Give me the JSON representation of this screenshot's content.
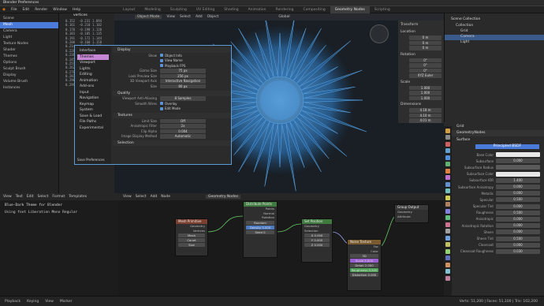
{
  "app": {
    "title": "Blender Preferences"
  },
  "topbar": {
    "items": [
      "File",
      "Edit",
      "Render",
      "Window",
      "Help",
      "Layout",
      "Modeling",
      "Sculpting",
      "UV Editing",
      "Texture Paint",
      "Shading",
      "Animation",
      "Rendering",
      "Compositing",
      "Geometry Nodes",
      "Scripting"
    ]
  },
  "tabs": [
    {
      "label": "Layout",
      "active": false
    },
    {
      "label": "Modeling",
      "active": false
    },
    {
      "label": "Sculpting",
      "active": false
    },
    {
      "label": "UV Editing",
      "active": false
    },
    {
      "label": "Shading",
      "active": false
    },
    {
      "label": "Animation",
      "active": false
    },
    {
      "label": "Rendering",
      "active": false
    },
    {
      "label": "Compositing",
      "active": false
    },
    {
      "label": "Geometry Nodes",
      "active": true
    },
    {
      "label": "Scripting",
      "active": false
    }
  ],
  "outliner": {
    "items": [
      {
        "label": "Scene",
        "sel": false
      },
      {
        "label": "Mesh",
        "sel": true
      },
      {
        "label": "Camera",
        "sel": false
      },
      {
        "label": "Light",
        "sel": false
      },
      {
        "label": "Texture Nodes",
        "sel": false
      },
      {
        "label": "Shader",
        "sel": false
      },
      {
        "label": "Themes",
        "sel": false
      },
      {
        "label": "Options",
        "sel": false
      },
      {
        "label": "Sculpt Brush",
        "sel": false
      },
      {
        "label": "Display",
        "sel": false
      },
      {
        "label": "Volume Brush",
        "sel": false
      },
      {
        "label": "Instances",
        "sel": false
      }
    ]
  },
  "table": {
    "header": "vertices",
    "rows": [
      [
        "0.152",
        "-0.231",
        "1.094"
      ],
      [
        "0.161",
        "-0.210",
        "1.102"
      ],
      [
        "0.170",
        "-0.198",
        "1.120"
      ],
      [
        "0.183",
        "-0.185",
        "1.135"
      ],
      [
        "0.191",
        "-0.172",
        "1.144"
      ],
      [
        "0.200",
        "-0.160",
        "1.158"
      ],
      [
        "0.214",
        "-0.143",
        "1.163"
      ],
      [
        "0.228",
        "-0.130",
        "1.171"
      ],
      [
        "0.236",
        "-0.118",
        "1.180"
      ],
      [
        "0.245",
        "-0.101",
        "1.192"
      ],
      [
        "0.251",
        "-0.088",
        "1.201"
      ],
      [
        "0.262",
        "-0.074",
        "1.210"
      ],
      [
        "0.270",
        "-0.060",
        "1.219"
      ],
      [
        "0.281",
        "-0.047",
        "1.226"
      ],
      [
        "0.290",
        "-0.031",
        "1.234"
      ],
      [
        "0.299",
        "-0.019",
        "1.241"
      ]
    ]
  },
  "viewport": {
    "mode": "Object Mode",
    "view": "View",
    "select": "Select",
    "add": "Add",
    "object": "Object",
    "global": "Global"
  },
  "prefs": {
    "sidebar": [
      {
        "label": "Interface",
        "sel": false
      },
      {
        "label": "Themes",
        "sel": true
      },
      {
        "label": "Viewport",
        "sel": false
      },
      {
        "label": "Lights",
        "sel": false
      },
      {
        "label": "Editing",
        "sel": false
      },
      {
        "label": "Animation",
        "sel": false
      },
      {
        "label": "Add-ons",
        "sel": false
      },
      {
        "label": "Input",
        "sel": false
      },
      {
        "label": "Navigation",
        "sel": false
      },
      {
        "label": "Keymap",
        "sel": false
      },
      {
        "label": "System",
        "sel": false
      },
      {
        "label": "Save & Load",
        "sel": false
      },
      {
        "label": "File Paths",
        "sel": false
      },
      {
        "label": "Experimental",
        "sel": false
      }
    ],
    "footer": "Save Preferences",
    "display_title": "Display",
    "display_rows": [
      {
        "label": "Show",
        "value": "Object Info"
      },
      {
        "label": "",
        "value": "View Name"
      },
      {
        "label": "",
        "value": "Playback FPS"
      },
      {
        "label": "Gizmo Size",
        "value": "75 px"
      },
      {
        "label": "Look Preview Size",
        "value": "256 px"
      },
      {
        "label": "3D Viewport Axis",
        "value": "Interactive Navigation"
      },
      {
        "label": "Size",
        "value": "80 px"
      }
    ],
    "quality_title": "Quality",
    "quality_rows": [
      {
        "label": "Viewport Anti-Aliasing",
        "value": "8 Samples"
      },
      {
        "label": "Smooth Wires",
        "value": "Overlay"
      },
      {
        "label": "",
        "value": "Edit Mode"
      }
    ],
    "textures_title": "Textures",
    "texture_rows": [
      {
        "label": "Limit Size",
        "value": "Off"
      },
      {
        "label": "Anisotropic Filter",
        "value": "2x"
      },
      {
        "label": "Clip Alpha",
        "value": "0.004"
      },
      {
        "label": "Image Display Method",
        "value": "Automatic"
      }
    ],
    "selection_title": "Selection"
  },
  "npanel": {
    "transform": "Transform",
    "location": "Location",
    "rotation": "Rotation",
    "scale": "Scale",
    "dims": "Dimensions",
    "loc_vals": [
      "0 m",
      "0 m",
      "0 m"
    ],
    "rot_vals": [
      "0°",
      "0°",
      "0°"
    ],
    "mode": "XYZ Euler",
    "scale_vals": [
      "1.000",
      "1.000",
      "1.000"
    ],
    "dim_vals": [
      "4.18 m",
      "4.10 m",
      "4.01 m"
    ]
  },
  "collection": {
    "title": "Scene Collection",
    "items": [
      "Collection",
      "Grid",
      "Camera",
      "Light"
    ]
  },
  "text_editor": {
    "menu": [
      "View",
      "Text",
      "Edit",
      "Select",
      "Format",
      "Templates"
    ],
    "title": "Blue-Dark Theme for Blender",
    "line": "Using font Liberation Mono Regular"
  },
  "nodes": {
    "header": [
      "View",
      "Select",
      "Add",
      "Node"
    ],
    "tree": "Geometry Nodes",
    "n1": {
      "title": "Mesh Primitive",
      "rows": [
        "Geometry",
        "Vertices"
      ],
      "fields": [
        "Mesh",
        "Count",
        "Size"
      ]
    },
    "n2": {
      "title": "Distribute Points",
      "rows": [
        "Points",
        "Normal",
        "Rotation"
      ],
      "fields": [
        "Random",
        "Density 5.000",
        "Seed 0"
      ]
    },
    "n3": {
      "title": "Set Position",
      "rows": [
        "Geometry",
        "Selection",
        "Position",
        "Offset"
      ],
      "fields": [
        "X 0.000",
        "Y 0.000",
        "Z 0.000"
      ]
    },
    "n4": {
      "title": "Noise Texture",
      "rows": [
        "Fac",
        "Color"
      ],
      "fields": [
        "3D",
        "Scale 5.000",
        "Detail 2.000",
        "Roughness 0.500",
        "Distortion 0.000"
      ]
    },
    "group": {
      "title": "Group Output",
      "rows": [
        "Geometry",
        "Attribute"
      ]
    }
  },
  "props": {
    "object": "Grid",
    "modifier": "GeometryNodes",
    "surface": "Surface",
    "principled": "Principled BSDF",
    "rows": [
      {
        "label": "Base Color",
        "value": ""
      },
      {
        "label": "Subsurface",
        "value": "0.000"
      },
      {
        "label": "Subsurface Radius",
        "value": ""
      },
      {
        "label": "Subsurface Color",
        "value": ""
      },
      {
        "label": "Subsurface IOR",
        "value": "1.400"
      },
      {
        "label": "Subsurface Anisotropy",
        "value": "0.000"
      },
      {
        "label": "Metallic",
        "value": "0.000"
      },
      {
        "label": "Specular",
        "value": "0.500"
      },
      {
        "label": "Specular Tint",
        "value": "0.000"
      },
      {
        "label": "Roughness",
        "value": "0.500"
      },
      {
        "label": "Anisotropic",
        "value": "0.000"
      },
      {
        "label": "Anisotropic Rotation",
        "value": "0.000"
      },
      {
        "label": "Sheen",
        "value": "0.000"
      },
      {
        "label": "Sheen Tint",
        "value": "0.500"
      },
      {
        "label": "Clearcoat",
        "value": "0.000"
      },
      {
        "label": "Clearcoat Roughness",
        "value": "0.030"
      }
    ]
  },
  "status": {
    "items": [
      "Playback",
      "Keying",
      "View",
      "Marker"
    ],
    "info": "Verts: 51,200 | Faces: 51,100 | Tris: 102,200"
  },
  "colors": {
    "accent": "#4b7bd8",
    "pink": "#c586d4",
    "node_green": "#3f7a3f",
    "node_red": "#7a3f2f",
    "node_purple": "#5b3f7a"
  }
}
